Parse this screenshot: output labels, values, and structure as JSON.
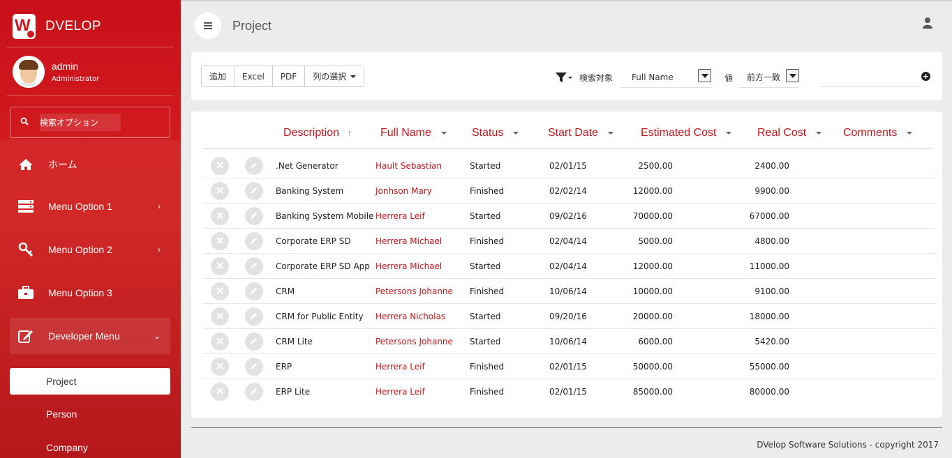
{
  "brand": {
    "logo_letter": "W",
    "name": "DVELOP"
  },
  "user": {
    "name": "admin",
    "role": "Administrator"
  },
  "sidebar": {
    "search_placeholder": "検索オプション",
    "items": [
      {
        "label": "ホーム",
        "icon": "home-icon"
      },
      {
        "label": "Menu Option 1",
        "icon": "server-icon"
      },
      {
        "label": "Menu Option 2",
        "icon": "key-icon"
      },
      {
        "label": "Menu Option 3",
        "icon": "briefcase-icon"
      },
      {
        "label": "Developer Menu",
        "icon": "edit-icon"
      }
    ],
    "sub_items": [
      {
        "label": "Project",
        "active": true
      },
      {
        "label": "Person"
      },
      {
        "label": "Company"
      }
    ]
  },
  "header": {
    "title": "Project"
  },
  "toolbar": {
    "add_label": "追加",
    "excel_label": "Excel",
    "pdf_label": "PDF",
    "columns_label": "列の選択",
    "search_target_label": "検索対象",
    "search_field_value": "Full Name",
    "value_label": "値",
    "match_mode_value": "前方一致",
    "value_input": ""
  },
  "table": {
    "columns": [
      "Description",
      "Full Name",
      "Status",
      "Start Date",
      "Estimated Cost",
      "Real Cost",
      "Comments"
    ],
    "rows": [
      {
        "description": ".Net Generator",
        "full_name": "Hault Sebastian",
        "status": "Started",
        "start_date": "02/01/15",
        "estimated_cost": "2500.00",
        "real_cost": "2400.00"
      },
      {
        "description": "Banking System",
        "full_name": "Jonhson Mary",
        "status": "Finished",
        "start_date": "02/02/14",
        "estimated_cost": "12000.00",
        "real_cost": "9900.00"
      },
      {
        "description": "Banking System Mobile",
        "full_name": "Herrera Leif",
        "status": "Started",
        "start_date": "09/02/16",
        "estimated_cost": "70000.00",
        "real_cost": "67000.00"
      },
      {
        "description": "Corporate ERP SD",
        "full_name": "Herrera Michael",
        "status": "Finished",
        "start_date": "02/04/14",
        "estimated_cost": "5000.00",
        "real_cost": "4800.00"
      },
      {
        "description": "Corporate ERP SD App",
        "full_name": "Herrera Michael",
        "status": "Started",
        "start_date": "02/04/14",
        "estimated_cost": "12000.00",
        "real_cost": "11000.00"
      },
      {
        "description": "CRM",
        "full_name": "Petersons Johanne",
        "status": "Finished",
        "start_date": "10/06/14",
        "estimated_cost": "10000.00",
        "real_cost": "9100.00"
      },
      {
        "description": "CRM for Public Entity",
        "full_name": "Herrera Nicholas",
        "status": "Started",
        "start_date": "09/20/16",
        "estimated_cost": "20000.00",
        "real_cost": "18000.00"
      },
      {
        "description": "CRM Lite",
        "full_name": "Petersons Johanne",
        "status": "Started",
        "start_date": "10/06/14",
        "estimated_cost": "6000.00",
        "real_cost": "5420.00"
      },
      {
        "description": "ERP",
        "full_name": "Herrera Leif",
        "status": "Finished",
        "start_date": "02/01/15",
        "estimated_cost": "50000.00",
        "real_cost": "55000.00"
      },
      {
        "description": "ERP Lite",
        "full_name": "Herrera Leif",
        "status": "Finished",
        "start_date": "02/01/15",
        "estimated_cost": "85000.00",
        "real_cost": "80000.00"
      }
    ]
  },
  "footer": {
    "text": "DVelop Software Solutions - copyright 2017"
  },
  "colors": {
    "brand_red": "#c4161c",
    "sidebar_red": "#d01820"
  }
}
